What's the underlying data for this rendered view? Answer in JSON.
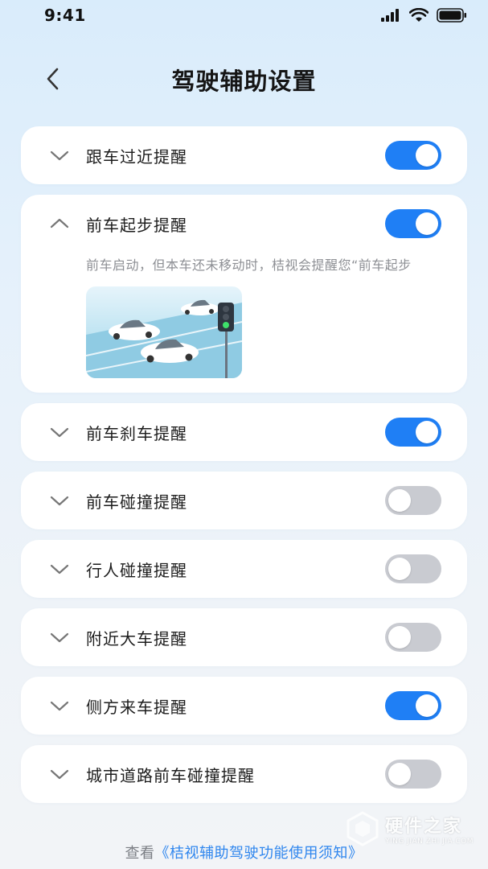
{
  "status_bar": {
    "time": "9:41",
    "icons": [
      "signal-icon",
      "wifi-icon",
      "battery-icon"
    ]
  },
  "header": {
    "title": "驾驶辅助设置",
    "back_icon": "chevron-left-icon"
  },
  "items": [
    {
      "label": "跟车过近提醒",
      "enabled": true,
      "expanded": false
    },
    {
      "label": "前车起步提醒",
      "enabled": true,
      "expanded": true,
      "description": "前车启动，但本车还未移动时，桔视会提醒您“前车起步"
    },
    {
      "label": "前车刹车提醒",
      "enabled": true,
      "expanded": false
    },
    {
      "label": "前车碰撞提醒",
      "enabled": false,
      "expanded": false
    },
    {
      "label": "行人碰撞提醒",
      "enabled": false,
      "expanded": false
    },
    {
      "label": "附近大车提醒",
      "enabled": false,
      "expanded": false
    },
    {
      "label": "侧方来车提醒",
      "enabled": true,
      "expanded": false
    },
    {
      "label": "城市道路前车碰撞提醒",
      "enabled": false,
      "expanded": false
    }
  ],
  "footer": {
    "prefix": "查看",
    "link": "《桔视辅助驾驶功能使用须知》"
  },
  "watermark": {
    "main": "硬件之家",
    "sub": "YING JIAN ZHI JIA.COM"
  },
  "colors": {
    "accent": "#1f7ff5",
    "toggle_off": "#c9cbd1",
    "link": "#2f86ee"
  }
}
